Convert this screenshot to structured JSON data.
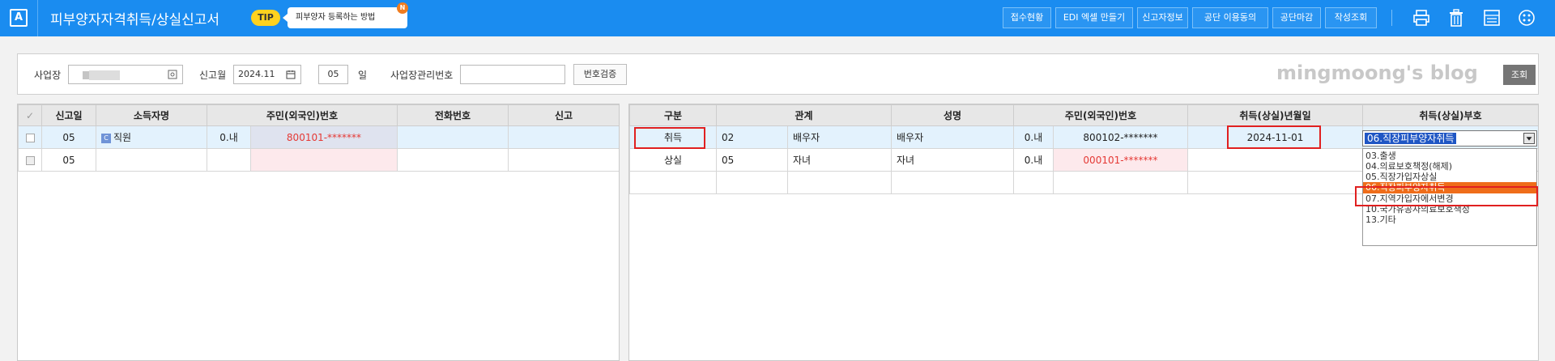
{
  "app": {
    "logo": "A",
    "title": "피부양자자격취득/상실신고서",
    "tip_label": "TIP",
    "tip_text": "피부양자 등록하는 방법",
    "new_badge": "N"
  },
  "toolbar": {
    "buttons": [
      "접수현황",
      "EDI 엑셀 만들기",
      "신고자정보",
      "공단 이용동의",
      "공단마감",
      "작성조회"
    ],
    "icons": [
      "printer-icon",
      "trash-icon",
      "spreadsheet-icon",
      "more-icon"
    ]
  },
  "filter": {
    "workplace_label": "사업장",
    "report_month_label": "신고월",
    "report_month_value": "2024.11",
    "day_value": "05",
    "day_unit": "일",
    "mgmt_no_label": "사업장관리번호",
    "mgmt_no_value": "",
    "verify_button": "번호검증",
    "watermark": "mingmoong's blog",
    "search_button": "조회"
  },
  "left_grid": {
    "headers": [
      "✓",
      "신고일",
      "소득자명",
      "주민(외국인)번호",
      "전화번호",
      "신고"
    ],
    "rows": [
      {
        "day": "05",
        "name": "직원",
        "name_icon": "C",
        "type": "0.내",
        "id": "800101-*******",
        "phone": "",
        "report": ""
      },
      {
        "day": "05",
        "name": "",
        "name_icon": "",
        "type": "",
        "id": "",
        "phone": "",
        "report": ""
      }
    ]
  },
  "right_grid": {
    "headers": [
      "구분",
      "관계",
      "성명",
      "주민(외국인)번호",
      "취득(상실)년월일",
      "취득(상실)부호"
    ],
    "rows": [
      {
        "kind": "취득",
        "rel_code": "02",
        "rel_name": "배우자",
        "name": "배우자",
        "type": "0.내",
        "id": "800102-*******",
        "date": "2024-11-01",
        "code": "06.직장피부양자취득"
      },
      {
        "kind": "상실",
        "rel_code": "05",
        "rel_name": "자녀",
        "name": "자녀",
        "type": "0.내",
        "id": "000101-*******",
        "date": "",
        "code": ""
      }
    ]
  },
  "dropdown": {
    "selected": "06.직장피부양자취득",
    "options": [
      "03.출생",
      "04.의료보호책정(해제)",
      "05.직장가입자상실",
      "06.직장피부양자취득",
      "07.지역가입자에서변경",
      "10.국가유공자의료보호책정",
      "13.기타"
    ],
    "highlighted_index": 3
  },
  "colors": {
    "topbar": "#1a8cf0",
    "highlight": "#ef6d1a",
    "annotation": "#e02020",
    "selection": "#1f56c4"
  }
}
